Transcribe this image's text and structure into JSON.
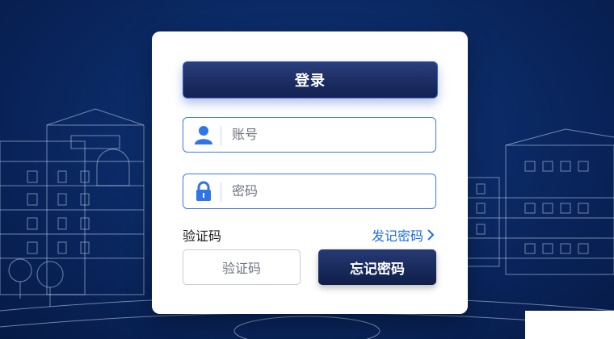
{
  "login": {
    "submit_label": "登录",
    "account_placeholder": "账号",
    "password_placeholder": "密码",
    "captcha_label": "验证码",
    "send_link_label": "发记密码",
    "captcha_input_placeholder": "验证码",
    "forgot_label": "忘记密码"
  },
  "icons": {
    "account": "user-icon",
    "password": "lock-icon",
    "link_arrow": "chevron-right-icon"
  },
  "colors": {
    "background": "#0b2a66",
    "primary_button": "#1a2b60",
    "accent": "#1f6fe0",
    "field_border": "#3a78e6"
  }
}
